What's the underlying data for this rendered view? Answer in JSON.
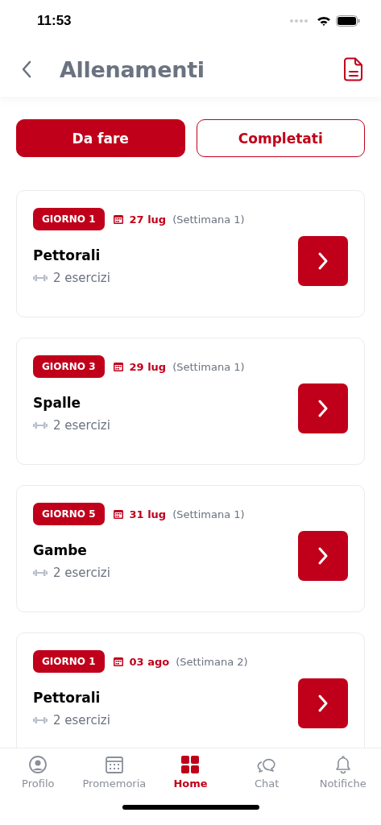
{
  "status_bar": {
    "time": "11:53"
  },
  "header": {
    "title": "Allenamenti"
  },
  "tabs": [
    {
      "label": "Da fare",
      "selected": true
    },
    {
      "label": "Completati",
      "selected": false
    }
  ],
  "workouts": [
    {
      "day": "GIORNO 1",
      "date": "27 lug",
      "week": "(Settimana 1)",
      "title": "Pettorali",
      "exercises": "2 esercizi"
    },
    {
      "day": "GIORNO 3",
      "date": "29 lug",
      "week": "(Settimana 1)",
      "title": "Spalle",
      "exercises": "2 esercizi"
    },
    {
      "day": "GIORNO 5",
      "date": "31 lug",
      "week": "(Settimana 1)",
      "title": "Gambe",
      "exercises": "2 esercizi"
    },
    {
      "day": "GIORNO 1",
      "date": "03 ago",
      "week": "(Settimana 2)",
      "title": "Pettorali",
      "exercises": "2 esercizi"
    }
  ],
  "nav": [
    {
      "kind": "profile",
      "label": "Profilo",
      "selected": false
    },
    {
      "kind": "calendar",
      "label": "Promemoria",
      "selected": false
    },
    {
      "kind": "home",
      "label": "Home",
      "selected": true
    },
    {
      "kind": "chat",
      "label": "Chat",
      "selected": false
    },
    {
      "kind": "bell",
      "label": "Notifiche",
      "selected": false
    }
  ]
}
